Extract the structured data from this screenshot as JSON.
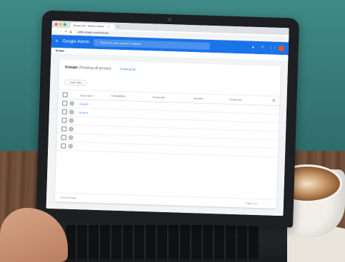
{
  "browser": {
    "tab_title": "Groups List - Admin Console",
    "tab_close": "×",
    "new_tab": "+",
    "url": "admin.google.com/ac/groups",
    "dot_colors": [
      "#ff5f57",
      "#febc2e",
      "#28c840"
    ]
  },
  "header": {
    "brand": "Google Admin",
    "search_placeholder": "Search for users, groups or settings",
    "accent": "#1a73e8",
    "icons": [
      "menu-icon",
      "search-icon",
      "notifications-icon",
      "help-icon",
      "apps-icon",
      "account-avatar"
    ]
  },
  "breadcrumb": "Groups",
  "main": {
    "title": "Groups",
    "subtitle": "Showing all groups",
    "create_link": "Create group",
    "add_filter": "+ Add a filter"
  },
  "table": {
    "columns": [
      "Group name",
      "Email address",
      "Access type",
      "Members",
      "Access type"
    ],
    "sort_icon": "↑",
    "rows": [
      {
        "name": "Group A",
        "email": "",
        "access": "",
        "members": ""
      },
      {
        "name": "Group B",
        "email": "",
        "access": "",
        "members": ""
      },
      {
        "name": "",
        "email": "",
        "access": "",
        "members": ""
      },
      {
        "name": "",
        "email": "",
        "access": "",
        "members": ""
      },
      {
        "name": "",
        "email": "",
        "access": "",
        "members": ""
      },
      {
        "name": "",
        "email": "",
        "access": "",
        "members": ""
      }
    ]
  },
  "footer": {
    "rows_per_page": "Rows per page",
    "page_info": "Page 1 of 1"
  }
}
